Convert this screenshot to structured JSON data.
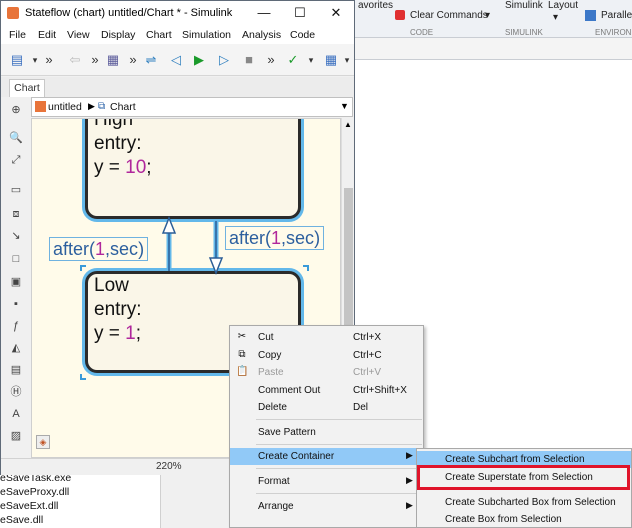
{
  "background_app": {
    "ribbon": {
      "favorites_label": "avorites",
      "clear_commands_label": "Clear Commands",
      "simulink_label": "Simulink",
      "layout_label": "Layout",
      "parallel_label": "Parallel",
      "sections": [
        "CODE",
        "SIMULINK",
        "ENVIRONM"
      ]
    },
    "file_list": [
      "eSaveTask.exe",
      "eSaveProxy.dll",
      "eSaveExt.dll",
      "eSave.dll"
    ]
  },
  "window": {
    "title": "Stateflow (chart) untitled/Chart * - Simulink",
    "controls": {
      "minimize": "—",
      "maximize": "☐",
      "close": "✕"
    },
    "menu": [
      "File",
      "Edit",
      "View",
      "Display",
      "Chart",
      "Simulation",
      "Analysis",
      "Code"
    ],
    "tab": "Chart",
    "breadcrumb": {
      "model": "untitled",
      "chart": "Chart"
    },
    "zoom": "220%"
  },
  "diagram": {
    "states": [
      {
        "name": "High",
        "entry": "entry:",
        "action_var": "y = ",
        "action_value": "10",
        "action_end": ";"
      },
      {
        "name": "Low",
        "entry": "entry:",
        "action_var": "y = ",
        "action_value": "1",
        "action_end": ";"
      }
    ],
    "transitions": [
      {
        "prefix": "after(",
        "n": "1",
        "sep": ",",
        "unit": "sec",
        "suffix": ")"
      },
      {
        "prefix": "after(",
        "n": "1",
        "sep": ",",
        "unit": "sec",
        "suffix": ")"
      }
    ]
  },
  "context_menu": {
    "items": [
      {
        "label": "Cut",
        "shortcut": "Ctrl+X",
        "icon": "scissors-icon",
        "enabled": true
      },
      {
        "label": "Copy",
        "shortcut": "Ctrl+C",
        "icon": "copy-icon",
        "enabled": true
      },
      {
        "label": "Paste",
        "shortcut": "Ctrl+V",
        "icon": "paste-icon",
        "enabled": false
      },
      {
        "label": "Comment Out",
        "shortcut": "Ctrl+Shift+X",
        "enabled": true
      },
      {
        "label": "Delete",
        "shortcut": "Del",
        "enabled": true
      },
      {
        "label": "Save Pattern",
        "enabled": true
      },
      {
        "label": "Create Container",
        "submenu": true,
        "highlighted": true
      },
      {
        "label": "Format",
        "submenu": true
      },
      {
        "label": "Arrange",
        "submenu": true
      }
    ]
  },
  "submenu": {
    "items": [
      {
        "label": "Create Subchart from Selection",
        "highlighted": true
      },
      {
        "label": "Create Superstate from Selection",
        "outlined": true
      },
      {
        "label": "Create Subcharted Box from Selection"
      },
      {
        "label": "Create Box from Selection"
      }
    ]
  },
  "colors": {
    "highlight": "#91c9f7",
    "callout": "#e0142a",
    "state_border_glow": "#63b8ea",
    "number": "#b0279c"
  }
}
